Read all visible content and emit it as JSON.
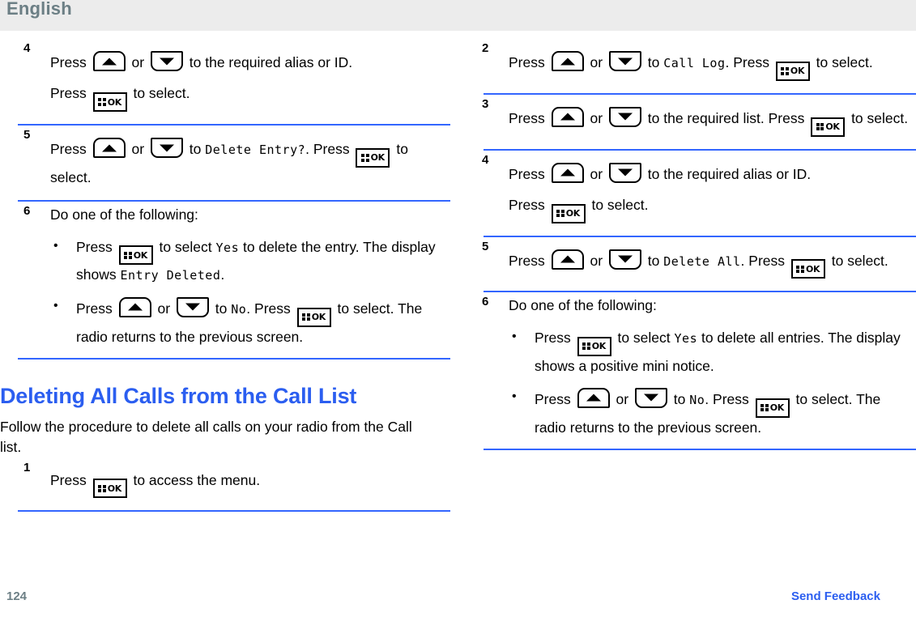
{
  "header": {
    "language_label": "English"
  },
  "icons": {
    "up_key": "arrow-up-key-icon",
    "down_key": "arrow-down-key-icon",
    "ok_key": "menu-ok-key-icon",
    "ok_key_label": "OK"
  },
  "left_column": {
    "steps": [
      {
        "number": "4",
        "lines": [
          {
            "parts": [
              {
                "t": "text",
                "v": "Press "
              },
              {
                "t": "key",
                "v": "up"
              },
              {
                "t": "text",
                "v": " or "
              },
              {
                "t": "key",
                "v": "down"
              },
              {
                "t": "text",
                "v": " to the required alias or ID."
              }
            ]
          },
          {
            "parts": [
              {
                "t": "text",
                "v": "Press "
              },
              {
                "t": "key",
                "v": "ok"
              },
              {
                "t": "text",
                "v": " to select."
              }
            ]
          }
        ]
      },
      {
        "number": "5",
        "lines": [
          {
            "parts": [
              {
                "t": "text",
                "v": "Press "
              },
              {
                "t": "key",
                "v": "up"
              },
              {
                "t": "text",
                "v": " or "
              },
              {
                "t": "key",
                "v": "down"
              },
              {
                "t": "text",
                "v": " to "
              },
              {
                "t": "mono",
                "v": "Delete Entry?"
              },
              {
                "t": "text",
                "v": ". Press "
              },
              {
                "t": "key",
                "v": "ok"
              },
              {
                "t": "text",
                "v": " to select."
              }
            ]
          }
        ]
      },
      {
        "number": "6",
        "inline_title": "Do one of the following:",
        "bullets": [
          {
            "parts": [
              {
                "t": "text",
                "v": "Press "
              },
              {
                "t": "key",
                "v": "ok"
              },
              {
                "t": "text",
                "v": " to select "
              },
              {
                "t": "mono",
                "v": "Yes"
              },
              {
                "t": "text",
                "v": " to delete the entry. The display shows "
              },
              {
                "t": "mono",
                "v": "Entry Deleted"
              },
              {
                "t": "text",
                "v": "."
              }
            ]
          },
          {
            "parts": [
              {
                "t": "text",
                "v": "Press "
              },
              {
                "t": "key",
                "v": "up"
              },
              {
                "t": "text",
                "v": " or "
              },
              {
                "t": "key",
                "v": "down"
              },
              {
                "t": "text",
                "v": " to "
              },
              {
                "t": "mono",
                "v": "No"
              },
              {
                "t": "text",
                "v": ". Press "
              },
              {
                "t": "key",
                "v": "ok"
              },
              {
                "t": "text",
                "v": " to select. The radio returns to the previous screen."
              }
            ]
          }
        ]
      }
    ],
    "section": {
      "heading": "Deleting All Calls from the Call List",
      "intro": "Follow the procedure to delete all calls on your radio from the Call list.",
      "steps": [
        {
          "number": "1",
          "lines": [
            {
              "parts": [
                {
                  "t": "text",
                  "v": "Press "
                },
                {
                  "t": "key",
                  "v": "ok"
                },
                {
                  "t": "text",
                  "v": " to access the menu."
                }
              ]
            }
          ]
        }
      ]
    }
  },
  "right_column": {
    "steps": [
      {
        "number": "2",
        "lines": [
          {
            "parts": [
              {
                "t": "text",
                "v": "Press "
              },
              {
                "t": "key",
                "v": "up"
              },
              {
                "t": "text",
                "v": " or "
              },
              {
                "t": "key",
                "v": "down"
              },
              {
                "t": "text",
                "v": " to "
              },
              {
                "t": "mono",
                "v": "Call Log"
              },
              {
                "t": "text",
                "v": ". Press "
              },
              {
                "t": "key",
                "v": "ok"
              },
              {
                "t": "text",
                "v": " to select."
              }
            ]
          }
        ]
      },
      {
        "number": "3",
        "lines": [
          {
            "parts": [
              {
                "t": "text",
                "v": "Press "
              },
              {
                "t": "key",
                "v": "up"
              },
              {
                "t": "text",
                "v": " or "
              },
              {
                "t": "key",
                "v": "down"
              },
              {
                "t": "text",
                "v": " to the required list. Press "
              },
              {
                "t": "key",
                "v": "ok"
              },
              {
                "t": "text",
                "v": " to select."
              }
            ]
          }
        ]
      },
      {
        "number": "4",
        "lines": [
          {
            "parts": [
              {
                "t": "text",
                "v": "Press "
              },
              {
                "t": "key",
                "v": "up"
              },
              {
                "t": "text",
                "v": " or "
              },
              {
                "t": "key",
                "v": "down"
              },
              {
                "t": "text",
                "v": " to the required alias or ID."
              }
            ]
          },
          {
            "parts": [
              {
                "t": "text",
                "v": "Press "
              },
              {
                "t": "key",
                "v": "ok"
              },
              {
                "t": "text",
                "v": " to select."
              }
            ]
          }
        ]
      },
      {
        "number": "5",
        "lines": [
          {
            "parts": [
              {
                "t": "text",
                "v": "Press "
              },
              {
                "t": "key",
                "v": "up"
              },
              {
                "t": "text",
                "v": " or "
              },
              {
                "t": "key",
                "v": "down"
              },
              {
                "t": "text",
                "v": " to "
              },
              {
                "t": "mono",
                "v": "Delete All"
              },
              {
                "t": "text",
                "v": ". Press "
              },
              {
                "t": "key",
                "v": "ok"
              },
              {
                "t": "text",
                "v": " to select."
              }
            ]
          }
        ]
      },
      {
        "number": "6",
        "inline_title": "Do one of the following:",
        "bullets": [
          {
            "parts": [
              {
                "t": "text",
                "v": "Press "
              },
              {
                "t": "key",
                "v": "ok"
              },
              {
                "t": "text",
                "v": " to select "
              },
              {
                "t": "mono",
                "v": "Yes"
              },
              {
                "t": "text",
                "v": " to delete all entries. The display shows a positive mini notice."
              }
            ]
          },
          {
            "parts": [
              {
                "t": "text",
                "v": "Press "
              },
              {
                "t": "key",
                "v": "up"
              },
              {
                "t": "text",
                "v": " or "
              },
              {
                "t": "key",
                "v": "down"
              },
              {
                "t": "text",
                "v": " to "
              },
              {
                "t": "mono",
                "v": "No"
              },
              {
                "t": "text",
                "v": ". Press "
              },
              {
                "t": "key",
                "v": "ok"
              },
              {
                "t": "text",
                "v": " to select. The radio returns to the previous screen."
              }
            ]
          }
        ]
      }
    ]
  },
  "footer": {
    "page_number": "124",
    "send_feedback": "Send Feedback"
  },
  "colors": {
    "heading_blue": "#2b5ef0",
    "rule_blue": "#3366ff",
    "header_band": "#ececec",
    "header_text": "#6c7f85"
  }
}
